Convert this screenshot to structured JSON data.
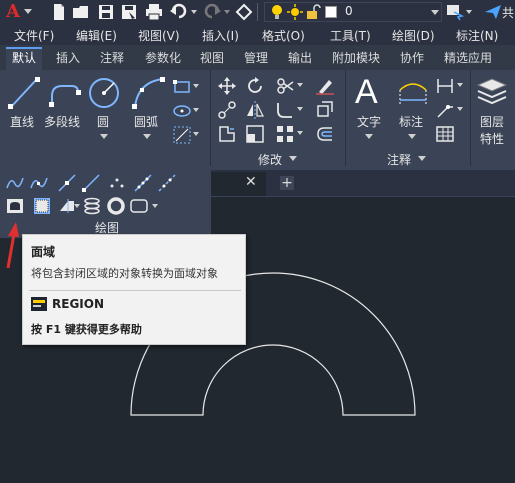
{
  "quick_access": {
    "app_logo": "A",
    "layer_value": "0",
    "right_label": "共"
  },
  "menu": {
    "items": [
      "文件(F)",
      "编辑(E)",
      "视图(V)",
      "插入(I)",
      "格式(O)",
      "工具(T)",
      "绘图(D)",
      "标注(N)"
    ]
  },
  "ribbon_tabs": {
    "items": [
      "默认",
      "插入",
      "注释",
      "参数化",
      "视图",
      "管理",
      "输出",
      "附加模块",
      "协作",
      "精选应用"
    ],
    "active": "默认"
  },
  "ribbon": {
    "draw": {
      "line": "直线",
      "polyline": "多段线",
      "circle": "圆",
      "arc": "圆弧",
      "title": "绘图"
    },
    "modify": {
      "title": "修改"
    },
    "annotation": {
      "text": "文字",
      "dimension": "标注",
      "title": "注释"
    },
    "layers": {
      "properties_line1": "图层",
      "properties_line2": "特性"
    }
  },
  "doc_tabs": {
    "close_glyph": "✕",
    "add_glyph": "+"
  },
  "tooltip": {
    "title": "面域",
    "description": "将包含封闭区域的对象转换为面域对象",
    "command": "REGION",
    "help": "按 F1 键获得更多帮助"
  },
  "colors": {
    "accent": "#5d9cec",
    "logo": "#e02a2a",
    "arrow": "#e03030",
    "canvas": "#212830",
    "ribbon": "#3b4456"
  }
}
